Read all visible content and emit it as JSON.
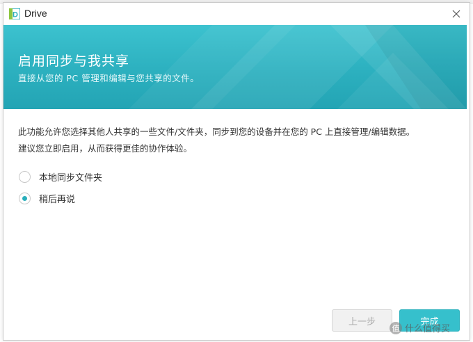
{
  "window": {
    "app_name": "Drive",
    "logo_letter": "D"
  },
  "banner": {
    "title": "启用同步与我共享",
    "subtitle": "直接从您的 PC 管理和编辑与您共享的文件。"
  },
  "description": {
    "line1": "此功能允许您选择其他人共享的一些文件/文件夹，同步到您的设备并在您的 PC 上直接管理/编辑数据。",
    "line2": "建议您立即启用，从而获得更佳的协作体验。"
  },
  "options": [
    {
      "label": "本地同步文件夹",
      "checked": false
    },
    {
      "label": "稍后再说",
      "checked": true
    }
  ],
  "buttons": {
    "prev_label": "上一步",
    "done_label": "完成"
  },
  "watermark": {
    "badge": "值",
    "text": "什么值得买"
  },
  "colors": {
    "accent": "#36c0cc",
    "banner_top": "#3cc2cf",
    "banner_bottom": "#23a4b4",
    "radio_checked": "#2aaebb"
  },
  "icons": {
    "logo": "drive-logo-icon",
    "close": "close-icon"
  }
}
